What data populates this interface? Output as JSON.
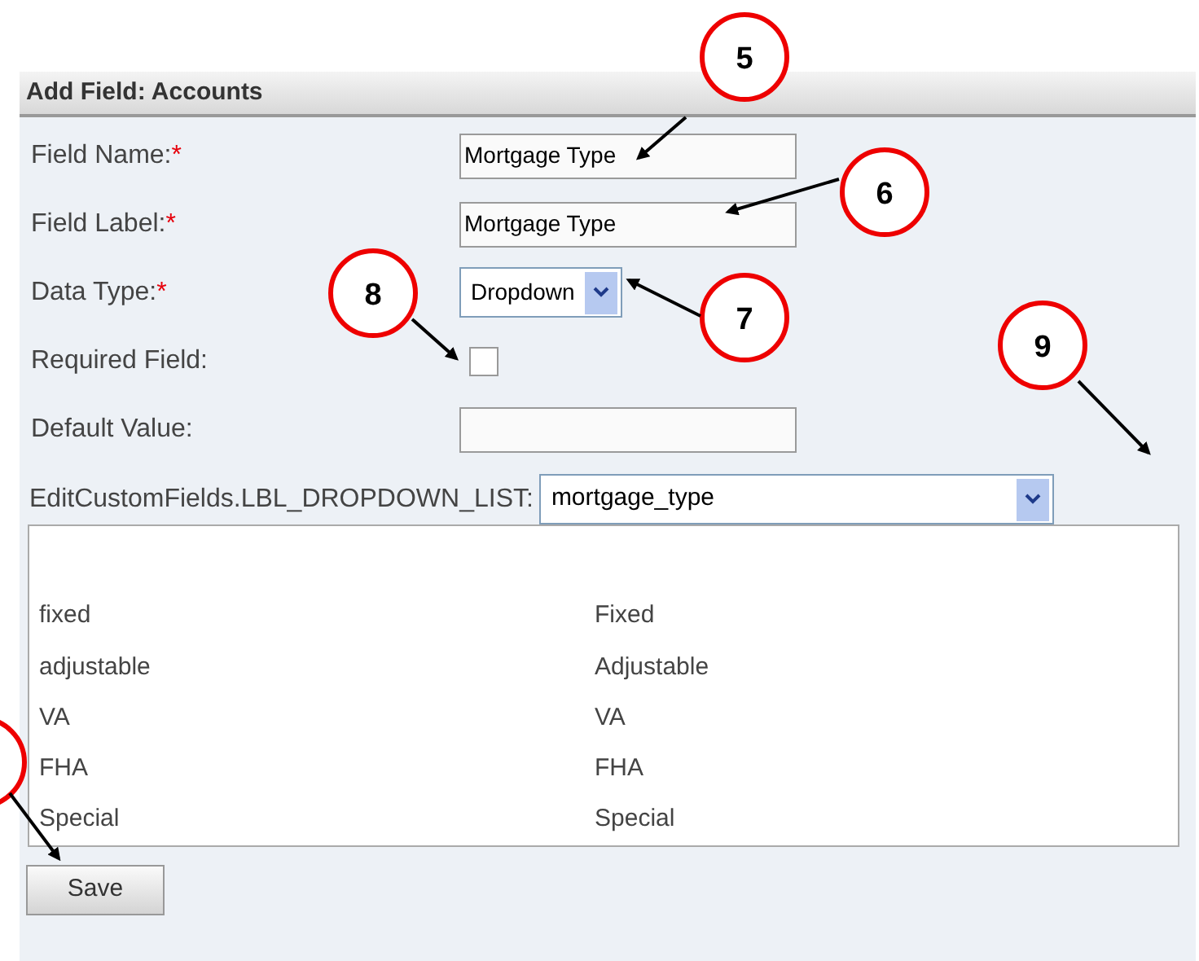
{
  "panel": {
    "title": "Add Field: Accounts"
  },
  "fields": [
    {
      "kind": "text",
      "label": "Field Name:",
      "required_mark": "*",
      "value": "Mortgage Type"
    },
    {
      "kind": "text",
      "label": "Field Label:",
      "required_mark": "*",
      "value": "Mortgage Type"
    },
    {
      "kind": "select",
      "label": "Data Type:",
      "required_mark": "*",
      "value": "Dropdown"
    },
    {
      "kind": "checkbox",
      "label": "Required Field:",
      "checked": false
    },
    {
      "kind": "text",
      "label": "Default Value:"
    }
  ],
  "dropdown_list": {
    "label": "EditCustomFields.LBL_DROPDOWN_LIST:",
    "value": "mortgage_type"
  },
  "options": [
    {
      "name": "fixed",
      "label": "Fixed"
    },
    {
      "name": "adjustable",
      "label": "Adjustable"
    },
    {
      "name": "VA",
      "label": "VA"
    },
    {
      "name": "FHA",
      "label": "FHA"
    },
    {
      "name": "Special",
      "label": "Special"
    }
  ],
  "save_button": "Save",
  "callouts": [
    {
      "kind": "numbered",
      "number": "5"
    },
    {
      "kind": "numbered",
      "number": "6"
    },
    {
      "kind": "numbered",
      "number": "7"
    },
    {
      "kind": "numbered",
      "number": "8"
    },
    {
      "kind": "numbered",
      "number": "9"
    },
    {
      "kind": "cut_off"
    }
  ]
}
